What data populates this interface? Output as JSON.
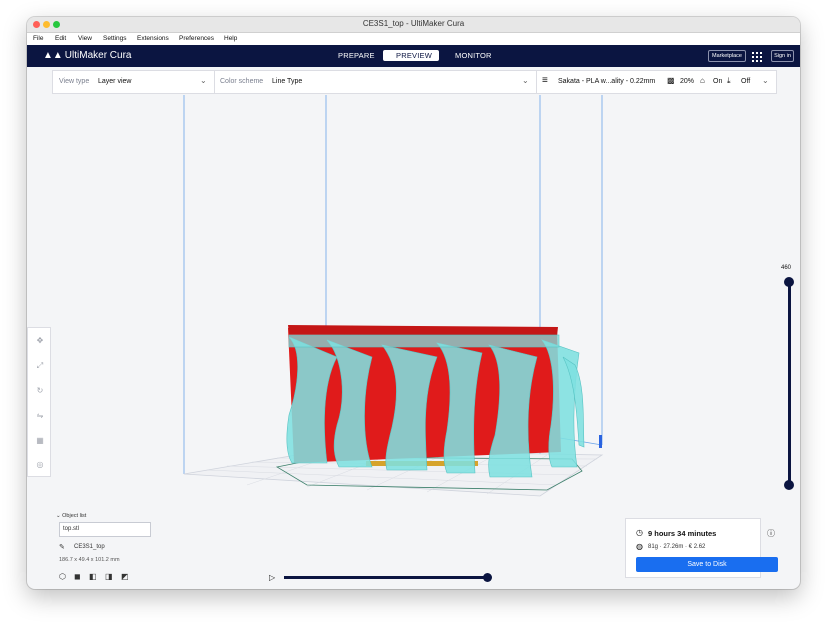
{
  "window": {
    "title": "CE3S1_top - UltiMaker Cura"
  },
  "menu": [
    "File",
    "Edit",
    "View",
    "Settings",
    "Extensions",
    "Preferences",
    "Help"
  ],
  "header": {
    "logo": "UltiMaker Cura",
    "stages": [
      "PREPARE",
      "PREVIEW",
      "MONITOR"
    ],
    "active_stage": "PREVIEW",
    "marketplace": "Marketplace",
    "sign_in": "Sign in"
  },
  "toolbar": {
    "view_type_label": "View type",
    "view_type_value": "Layer view",
    "color_scheme_label": "Color scheme",
    "color_scheme_value": "Line Type",
    "profile": "Sakata - PLA w...ality - 0.22mm",
    "infill": "20%",
    "support": "On",
    "adhesion": "Off"
  },
  "layer": {
    "current": "460"
  },
  "objects": {
    "list_label": "Object list",
    "file": "top.stl",
    "name": "CE3S1_top",
    "dimensions": "186.7 x 49.4 x 101.2 mm"
  },
  "print": {
    "time": "9 hours 34 minutes",
    "stats": "81g · 27.26m · € 2.62",
    "save_label": "Save to Disk"
  },
  "colors": {
    "header": "#0b1541",
    "accent": "#196ef0",
    "model": "#e01b1b",
    "support": "#7ee0e0"
  }
}
